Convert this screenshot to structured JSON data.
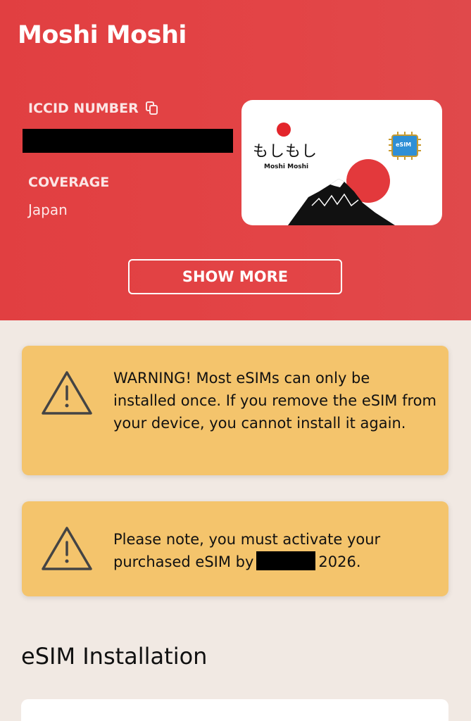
{
  "header": {
    "title": "Moshi Moshi",
    "iccid_label": "ICCID NUMBER",
    "coverage_label": "COVERAGE",
    "coverage_value": "Japan",
    "show_more_label": "SHOW MORE",
    "background_color": "#e13f41"
  },
  "sim_card": {
    "brand_jp": "もしもし",
    "brand": "Moshi Moshi",
    "chip_label": "eSIM"
  },
  "warnings": {
    "install_once": "WARNING! Most eSIMs can only be installed once. If you remove the eSIM from your device, you cannot install it again.",
    "activate_prefix": "Please note, you must activate your purchased eSIM by",
    "activate_suffix": "2026.",
    "background_color": "#f4c46c"
  },
  "installation": {
    "title": "eSIM Installation"
  },
  "icons": {
    "copy": "copy-icon",
    "warning": "warning-triangle-icon"
  }
}
